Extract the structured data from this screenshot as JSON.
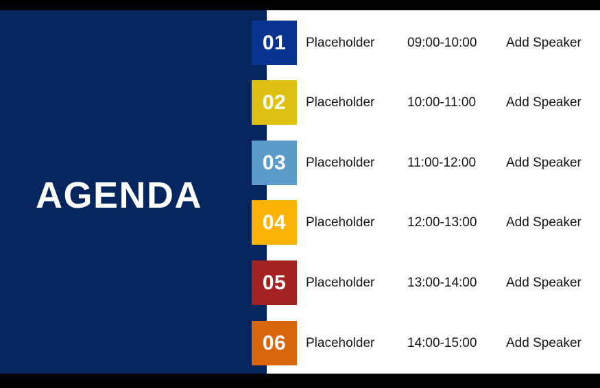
{
  "slide": {
    "title": "AGENDA",
    "colors": {
      "panel_navy": "#04255E",
      "frame_black": "#000000",
      "background": "#FFFFFF",
      "text_dark": "#141414"
    }
  },
  "agenda": {
    "rows": [
      {
        "number": "01",
        "title": "Placeholder",
        "time": "09:00-10:00",
        "speaker": "Add Speaker",
        "color": "#073490"
      },
      {
        "number": "02",
        "title": "Placeholder",
        "time": "10:00-11:00",
        "speaker": "Add Speaker",
        "color": "#DEC112"
      },
      {
        "number": "03",
        "title": "Placeholder",
        "time": "11:00-12:00",
        "speaker": "Add Speaker",
        "color": "#5B9BC9"
      },
      {
        "number": "04",
        "title": "Placeholder",
        "time": "12:00-13:00",
        "speaker": "Add Speaker",
        "color": "#FBB308"
      },
      {
        "number": "05",
        "title": "Placeholder",
        "time": "13:00-14:00",
        "speaker": "Add Speaker",
        "color": "#A32222"
      },
      {
        "number": "06",
        "title": "Placeholder",
        "time": "14:00-15:00",
        "speaker": "Add Speaker",
        "color": "#D9660A"
      }
    ]
  }
}
